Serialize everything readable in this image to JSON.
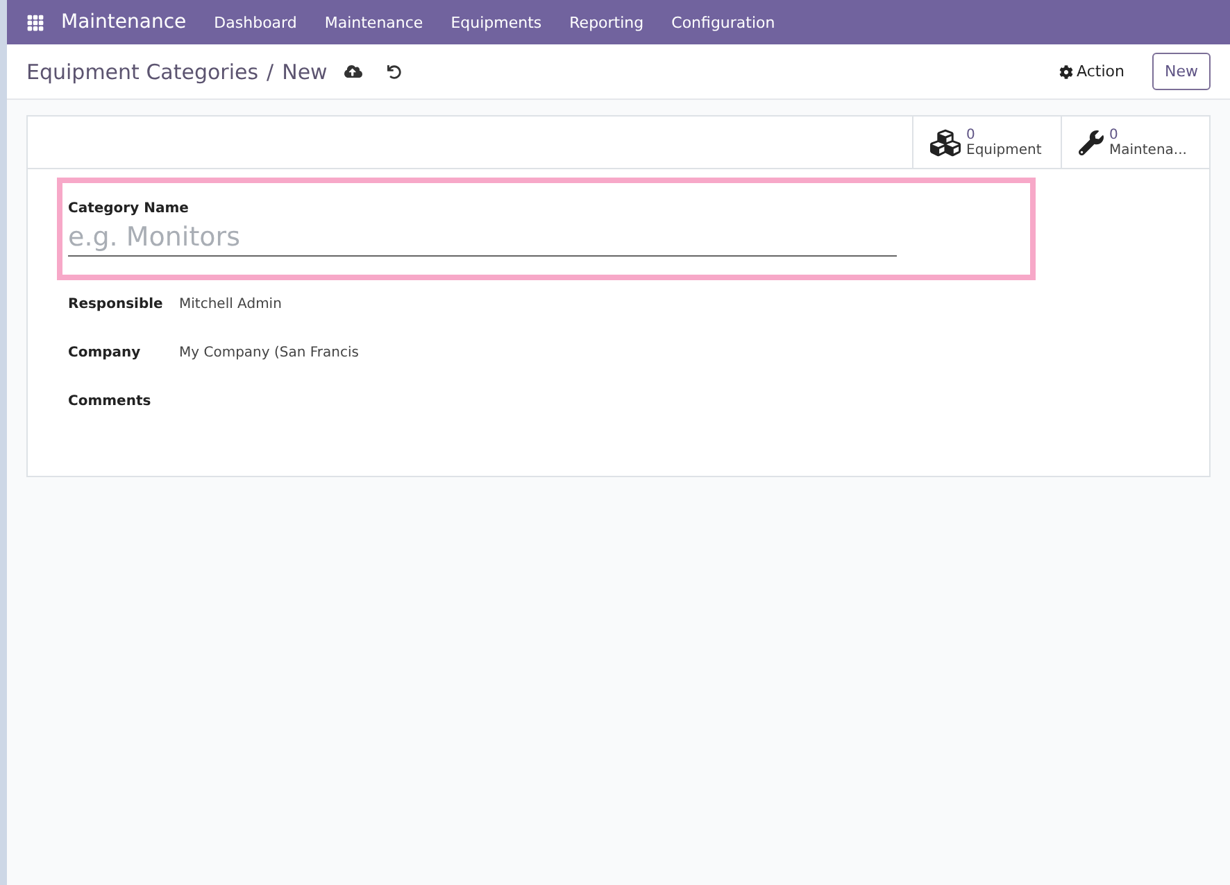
{
  "navbar": {
    "app_name": "Maintenance",
    "menu": [
      "Dashboard",
      "Maintenance",
      "Equipments",
      "Reporting",
      "Configuration"
    ]
  },
  "control_panel": {
    "breadcrumb": "Equipment Categories",
    "separator": "/",
    "current": "New",
    "action": "Action",
    "new_button": "New"
  },
  "smart_buttons": [
    {
      "kind": "cubes",
      "count": "0",
      "label": "Equipment"
    },
    {
      "kind": "wrench",
      "count": "0",
      "label": "Maintena..."
    }
  ],
  "form": {
    "name_label": "Category Name",
    "name_placeholder": "e.g. Monitors",
    "fields": [
      {
        "label": "Responsible",
        "value": "Mitchell Admin"
      },
      {
        "label": "Company",
        "value": "My Company (San Francis"
      },
      {
        "label": "Comments"
      }
    ]
  }
}
